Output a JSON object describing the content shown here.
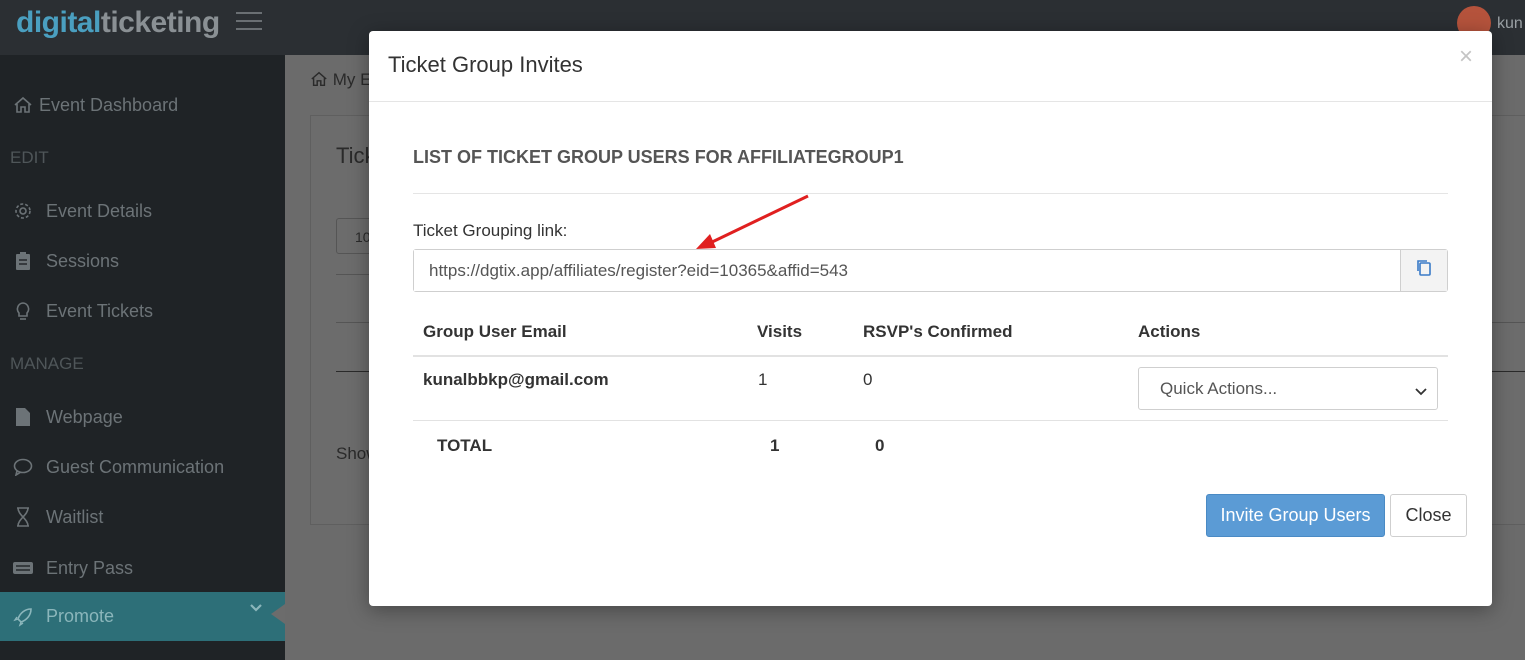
{
  "app": {
    "logo_part1": "digital",
    "logo_part2": "ticketing",
    "username": "kun"
  },
  "sidebar": {
    "items": [
      {
        "label": "Event Dashboard",
        "icon": "home-icon"
      },
      {
        "label": "Event Details",
        "icon": "gear-icon"
      },
      {
        "label": "Sessions",
        "icon": "clipboard-icon"
      },
      {
        "label": "Event Tickets",
        "icon": "lightbulb-icon"
      },
      {
        "label": "Webpage",
        "icon": "file-icon"
      },
      {
        "label": "Guest Communication",
        "icon": "chat-icon"
      },
      {
        "label": "Waitlist",
        "icon": "hourglass-icon"
      },
      {
        "label": "Entry Pass",
        "icon": "ticket-icon"
      },
      {
        "label": "Promote",
        "icon": "rocket-icon"
      }
    ],
    "sections": [
      "EDIT",
      "MANAGE"
    ],
    "active": "Promote"
  },
  "background": {
    "breadcrumb": "My E",
    "card_title": "Tick",
    "select_value": "10",
    "footer_text": "Show"
  },
  "modal": {
    "title": "Ticket Group Invites",
    "close_glyph": "×",
    "list_heading": "LIST OF TICKET GROUP USERS FOR AFFILIATEGROUP1",
    "link_label": "Ticket Grouping link:",
    "link_value": "https://dgtix.app/affiliates/register?eid=10365&affid=543",
    "table": {
      "headers": [
        "Group User Email",
        "Visits",
        "RSVP's Confirmed",
        "Actions"
      ],
      "rows": [
        {
          "email": "kunalbbkp@gmail.com",
          "visits": "1",
          "rsvps": "0",
          "action": "Quick Actions..."
        }
      ],
      "total": {
        "label": "TOTAL",
        "visits": "1",
        "rsvps": "0"
      }
    },
    "invite_button": "Invite Group Users",
    "close_button": "Close"
  },
  "colors": {
    "accent": "#5b9bd5",
    "sidebar_active": "#2d6f78",
    "arrow": "#e02020"
  }
}
